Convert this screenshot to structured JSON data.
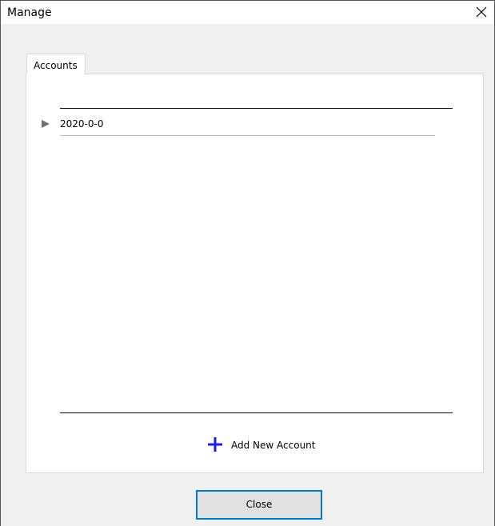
{
  "window": {
    "title": "Manage"
  },
  "tabs": [
    {
      "label": "Accounts",
      "selected": true
    }
  ],
  "accounts": [
    {
      "label": "2020-0-0",
      "expanded": false
    }
  ],
  "actions": {
    "add_account_label": "Add New Account",
    "close_label": "Close"
  },
  "colors": {
    "accent": "#0078d7",
    "plus_icon": "#1a1aff",
    "expander_arrow": "#707070"
  },
  "icons": {
    "close": "close-x-icon",
    "expander": "triangle-right-icon",
    "add": "plus-icon"
  }
}
